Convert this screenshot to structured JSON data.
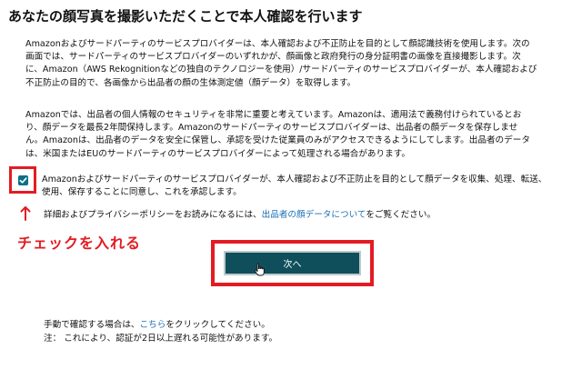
{
  "title": "あなたの顔写真を撮影いただくことで本人確認を行います",
  "intro": {
    "lines": [
      "Amazonおよびサードパーティのサービスプロバイダーは、本人確認および不正防止を目的として顔認識技術を使用します。次の",
      "画面では、サードパーティのサービスプロバイダーのいずれかが、顔画像と政府発行の身分証明書の画像を直接撮影します。次",
      "に、Amazon（AWS Rekognitionなどの独自のテクノロジーを使用）/サードパーティのサービスプロバイダーが、本人確認および",
      "不正防止の目的で、各画像から出品者の顔の生体測定値（顔データ）を取得します。"
    ]
  },
  "security": {
    "lines": [
      "Amazonでは、出品者の個人情報のセキュリティを非常に重要と考えています。Amazonは、適用法で義務付けられているとお",
      "り、顔データを最長2年間保持します。Amazonのサードパーティのサービスプロバイダーは、出品者の顔データを保存しませ",
      "ん。Amazonは、出品者のデータを安全に保管し、承認を受けた従業員のみがアクセスできるようにしてします。出品者のデータ",
      "は、米国またはEUのサードパーティのサービスプロバイダーによって処理される場合があります。"
    ]
  },
  "consent": {
    "checked": true,
    "lines": [
      "Amazonおよびサードパーティのサービスプロバイダーが、本人確認および不正防止を目的として顔データを収集、処理、転送、",
      "使用、保存することに同意し、これを承認します。"
    ]
  },
  "privacy": {
    "prefix": "詳細およびプライバシーポリシーをお読みになるには、",
    "link": "出品者の顔データについて",
    "suffix": "をご覧ください。"
  },
  "annotation": {
    "arrow": "↑",
    "text": "チェックを入れる",
    "color": "#e31b23"
  },
  "next_button": {
    "label": "次へ"
  },
  "manual": {
    "prefix": "手動で確認する場合は、",
    "link": "こちら",
    "suffix": "をクリックしてください。",
    "note": "注：  これにより、認証が2日以上遅れる可能性があります。"
  },
  "colors": {
    "accent_red": "#e31b23",
    "button_teal": "#0f4f5c",
    "link_blue": "#1a6fb3",
    "checkbox_teal": "#0b6f86"
  }
}
